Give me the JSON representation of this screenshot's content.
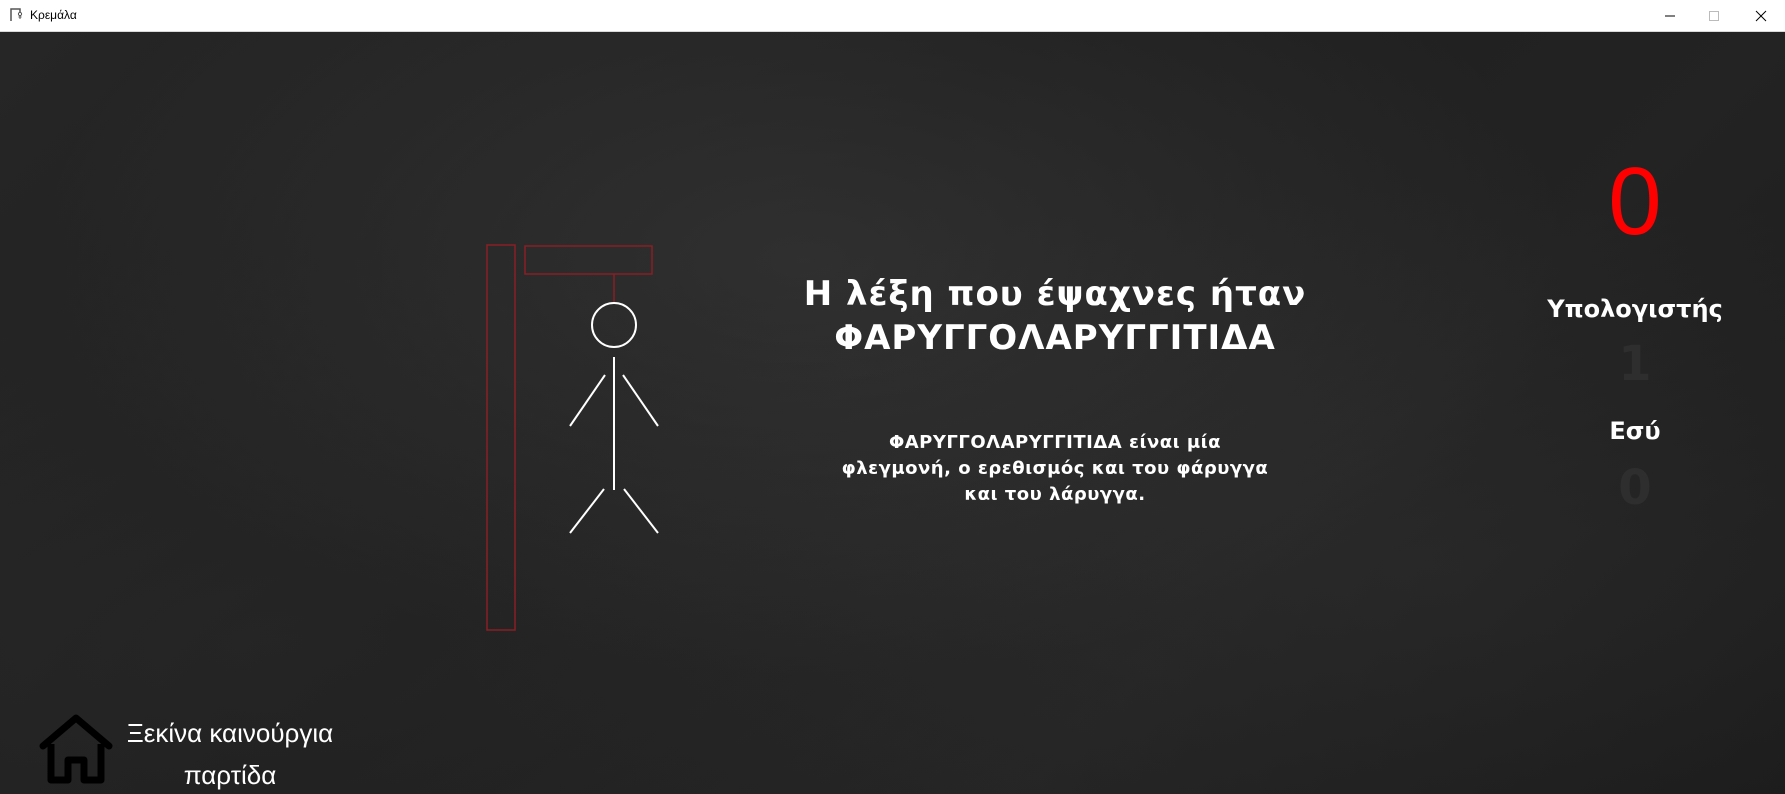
{
  "window": {
    "title": "Κρεμάλα",
    "icon": "hangman-app-icon"
  },
  "game": {
    "reveal_line1": "Η λέξη που έψαχνες ήταν",
    "reveal_word": "ΦΑΡΥΓΓΟΛΑΡΥΓΓΙΤΙΔΑ",
    "definition": "ΦΑΡΥΓΓΟΛΑΡΥΓΓΙΤΙΔΑ είναι μία φλεγμονή, ο ερεθισμός και του φάρυγγα και του λάρυγγα."
  },
  "scoreboard": {
    "big_number": "0",
    "computer_label": "Υπολογιστής",
    "computer_score": "1",
    "user_label": "Εσύ",
    "user_score": "0"
  },
  "new_game": {
    "line1": "Ξεκίνα καινούργια",
    "line2": "παρτίδα",
    "icon": "home-icon"
  },
  "colors": {
    "big_number": "#ff0000",
    "gallows": "#8a1f24",
    "figure": "#ffffff",
    "faded_score": "#2e2e2e"
  }
}
